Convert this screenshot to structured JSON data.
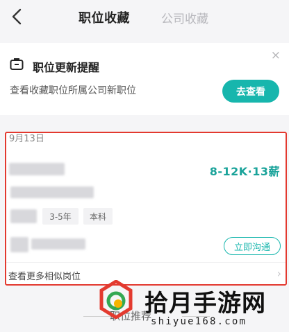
{
  "header": {
    "tabs": [
      {
        "label": "职位收藏",
        "active": true
      },
      {
        "label": "公司收藏",
        "active": false
      }
    ]
  },
  "reminder": {
    "title": "职位更新提醒",
    "subtitle": "查看收藏职位所属公司新职位",
    "button_label": "去查看",
    "close_label": "×"
  },
  "job_section": {
    "date": "9月13日",
    "salary": "8-12K·13薪",
    "tags": [
      "3-5年",
      "本科"
    ],
    "contact_label": "立即沟通",
    "more_label": "查看更多相似岗位",
    "more_arrow": "›"
  },
  "recommend": {
    "label": "职位推荐"
  },
  "watermark": {
    "title": "拾月手游网",
    "url": "shiyue168.com"
  },
  "colors": {
    "accent": "#17b6ad",
    "salary": "#1aa39a",
    "highlight_frame": "#e3392f"
  }
}
